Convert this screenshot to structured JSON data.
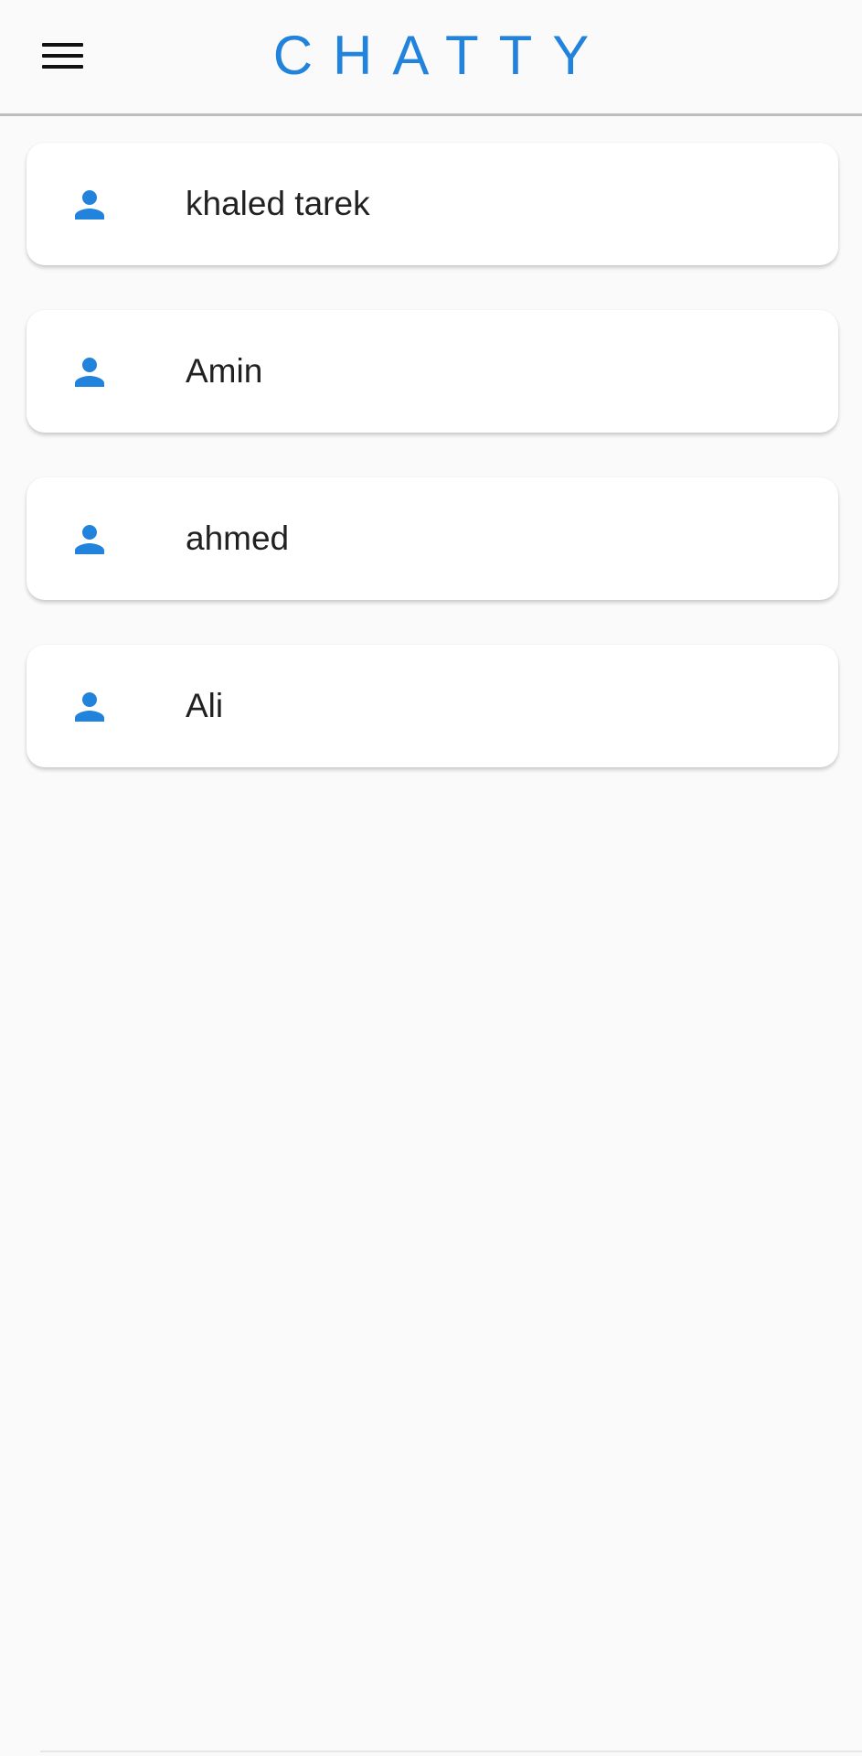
{
  "app": {
    "title": "CHATTY",
    "accent_color": "#2183dc",
    "menu_icon": "menu-icon"
  },
  "contacts": [
    {
      "name": "khaled tarek",
      "icon": "person-icon"
    },
    {
      "name": "Amin",
      "icon": "person-icon"
    },
    {
      "name": "ahmed",
      "icon": "person-icon"
    },
    {
      "name": "Ali",
      "icon": "person-icon"
    }
  ]
}
